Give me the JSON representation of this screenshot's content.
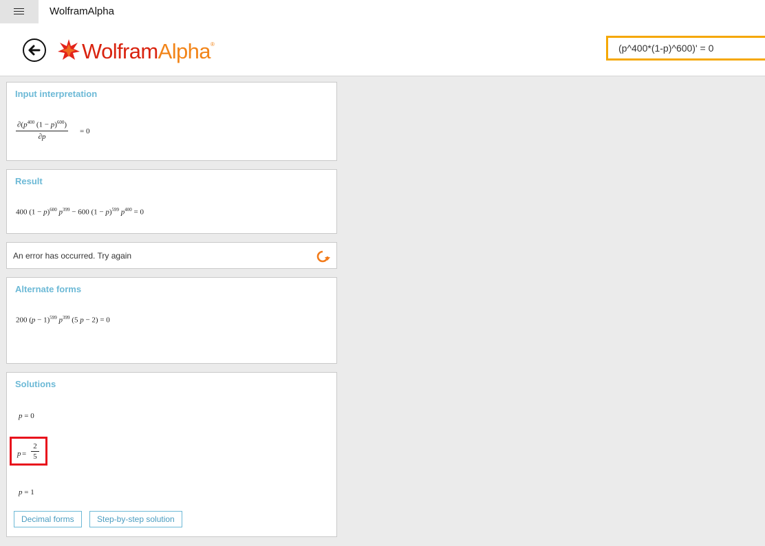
{
  "app": {
    "title": "WolframAlpha"
  },
  "logo": {
    "text_primary": "Wolfram",
    "text_secondary": "Alpha",
    "trademark": "®"
  },
  "search": {
    "value": "(p^400*(1-p)^600)' = 0"
  },
  "pods": {
    "input": {
      "title": "Input interpretation",
      "num_prefix": "∂(",
      "num_p": "p",
      "num_exp1": "400",
      "num_mid": " (1 − ",
      "num_p2": "p",
      "num_close": ")",
      "num_exp2": "600",
      "num_end": ")",
      "den_prefix": "∂",
      "den_var": "p",
      "rhs": "= 0"
    },
    "result": {
      "title": "Result",
      "t1": "400 (1 − ",
      "p1": "p",
      "t2": ")",
      "e1": "600",
      "p2": "p",
      "e2": "399",
      "t3": " − 600 (1 − ",
      "p3": "p",
      "t4": ")",
      "e3": "599",
      "p4": "p",
      "e4": "400",
      "t5": " = 0"
    },
    "error": {
      "message": "An error has occurred. Try again",
      "icon": "retry-icon"
    },
    "alternate": {
      "title": "Alternate forms",
      "t1": "200 (",
      "p1": "p",
      "t2": " − 1)",
      "e1": "599",
      "p2": "p",
      "e2": "399",
      "t3": " (5 ",
      "p3": "p",
      "t4": " − 2) = 0"
    },
    "solutions": {
      "title": "Solutions",
      "sol1_var": "p",
      "sol1_rhs": " = 0",
      "sol2_var": "p",
      "sol2_eq": " = ",
      "sol2_num": "2",
      "sol2_den": "5",
      "sol3_var": "p",
      "sol3_rhs": " = 1",
      "buttons": {
        "decimal": "Decimal forms",
        "step": "Step-by-step solution"
      }
    }
  },
  "colors": {
    "pod_title": "#6cb9d6",
    "search_border": "#f5a700",
    "highlight": "#e8101c",
    "logo_red": "#d9230f",
    "logo_orange": "#f28418"
  }
}
